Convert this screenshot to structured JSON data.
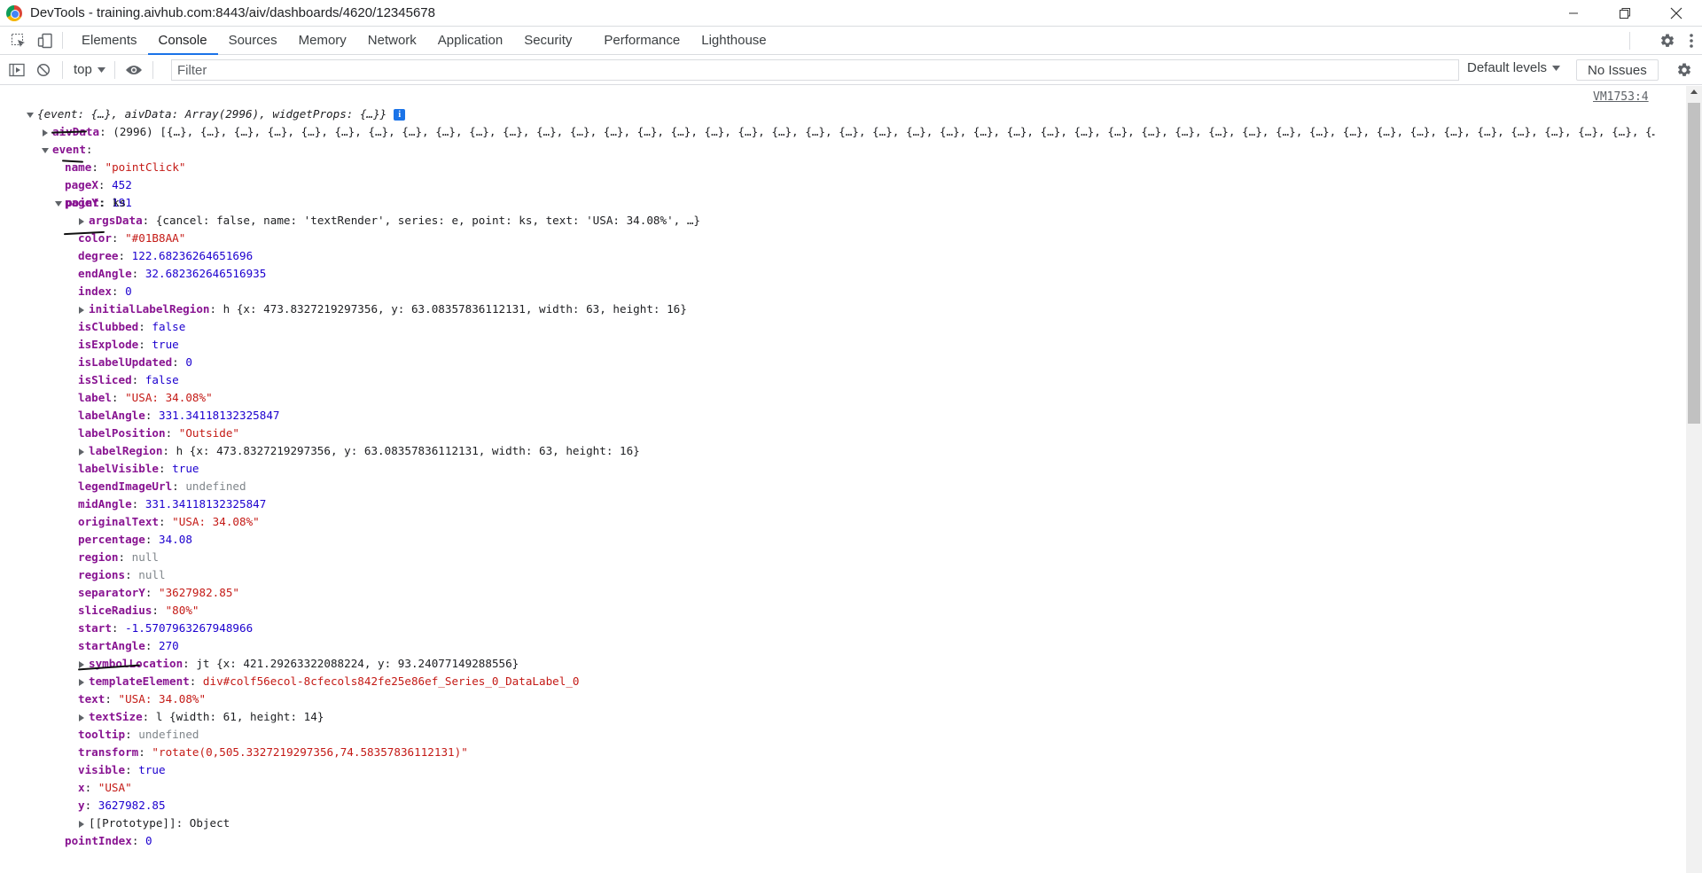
{
  "window": {
    "title": "DevTools - training.aivhub.com:8443/aiv/dashboards/4620/12345678",
    "controls": [
      "minimize",
      "restore",
      "close"
    ]
  },
  "tabs": [
    {
      "label": "Elements",
      "active": false
    },
    {
      "label": "Console",
      "active": true
    },
    {
      "label": "Sources",
      "active": false
    },
    {
      "label": "Memory",
      "active": false
    },
    {
      "label": "Network",
      "active": false
    },
    {
      "label": "Application",
      "active": false
    },
    {
      "label": "Security",
      "active": false
    },
    {
      "label": "Performance",
      "active": false
    },
    {
      "label": "Lighthouse",
      "active": false
    }
  ],
  "toolbar": {
    "context": "top",
    "filter_placeholder": "Filter",
    "levels": "Default levels",
    "issues": "No Issues"
  },
  "console": {
    "source_link": "VM1753:4",
    "summary": {
      "text": "{event: {…}, aivData: Array(2996), widgetProps: {…}}"
    },
    "aivData": {
      "key": "aivData",
      "count": "(2996)",
      "preview": "[{…}, {…}, {…}, {…}, {…}, {…}, {…}, {…}, {…}, {…}, {…}, {…}, {…}, {…}, {…}, {…}, {…}, {…}, {…}, {…}, {…}, {…}, {…}, {…}, {…}, {…}, {…}, {…}, {…}, {…}, {…}, {…}, {…}, {…}, {…}, {…}, {…}, {…}, {…}, {…}, {…}, {…}, {…}, {…}, {…}, {…}, {…}, {…}, {…}, {…}, {…}, {…}, {…}, {…}, {…}, {…}, {…}, {…}, {…}, {…}, {…}, {…}, {…}, {…}, {…}, {…}, {…}, {…}, {…}, {…}, {…}, {…}, {…}, {…}, {…}, {…}, {…}, {…}, {…}, {…}, {…}, {…}, {…}, {…}, {…}, {…}, {…}, {…}, {…}, {…}, {…}, {…}, {…}, {…}, {…}, {…}, {…}, {…}, {…}, {…}, …]"
    },
    "event_key": "event",
    "event_props": [
      {
        "key": "name",
        "value": "\"pointClick\"",
        "type": "string"
      },
      {
        "key": "pageX",
        "value": "452",
        "type": "number"
      },
      {
        "key": "pageY",
        "value": "191",
        "type": "number"
      }
    ],
    "point": {
      "key": "point",
      "value": "ks"
    },
    "point_props": [
      {
        "key": "argsData",
        "expandable": true,
        "value": "{cancel: false, name: 'textRender', series: e, point: ks, text: 'USA: 34.08%', …}",
        "type": "object"
      },
      {
        "key": "color",
        "value": "\"#01B8AA\"",
        "type": "string"
      },
      {
        "key": "degree",
        "value": "122.68236264651696",
        "type": "number"
      },
      {
        "key": "endAngle",
        "value": "32.682362646516935",
        "type": "number"
      },
      {
        "key": "index",
        "value": "0",
        "type": "number"
      },
      {
        "key": "initialLabelRegion",
        "expandable": true,
        "value": "h {x: 473.8327219297356, y: 63.08357836112131, width: 63, height: 16}",
        "type": "object"
      },
      {
        "key": "isClubbed",
        "value": "false",
        "type": "number"
      },
      {
        "key": "isExplode",
        "value": "true",
        "type": "number"
      },
      {
        "key": "isLabelUpdated",
        "value": "0",
        "type": "number"
      },
      {
        "key": "isSliced",
        "value": "false",
        "type": "number"
      },
      {
        "key": "label",
        "value": "\"USA: 34.08%\"",
        "type": "string"
      },
      {
        "key": "labelAngle",
        "value": "331.34118132325847",
        "type": "number"
      },
      {
        "key": "labelPosition",
        "value": "\"Outside\"",
        "type": "string"
      },
      {
        "key": "labelRegion",
        "expandable": true,
        "value": "h {x: 473.8327219297356, y: 63.08357836112131, width: 63, height: 16}",
        "type": "object"
      },
      {
        "key": "labelVisible",
        "value": "true",
        "type": "number"
      },
      {
        "key": "legendImageUrl",
        "value": "undefined",
        "type": "null"
      },
      {
        "key": "midAngle",
        "value": "331.34118132325847",
        "type": "number"
      },
      {
        "key": "originalText",
        "value": "\"USA: 34.08%\"",
        "type": "string"
      },
      {
        "key": "percentage",
        "value": "34.08",
        "type": "number"
      },
      {
        "key": "region",
        "value": "null",
        "type": "null"
      },
      {
        "key": "regions",
        "value": "null",
        "type": "null"
      },
      {
        "key": "separatorY",
        "value": "\"3627982.85\"",
        "type": "string"
      },
      {
        "key": "sliceRadius",
        "value": "\"80%\"",
        "type": "string"
      },
      {
        "key": "start",
        "value": "-1.5707963267948966",
        "type": "number"
      },
      {
        "key": "startAngle",
        "value": "270",
        "type": "number"
      },
      {
        "key": "symbolLocation",
        "expandable": true,
        "value": "jt {x: 421.29263322088224, y: 93.24077149288556}",
        "type": "object"
      },
      {
        "key": "templateElement",
        "expandable": true,
        "value": "div#colf56ecol-8cfecols842fe25e86ef_Series_0_DataLabel_0",
        "type": "string"
      },
      {
        "key": "text",
        "value": "\"USA: 34.08%\"",
        "type": "string"
      },
      {
        "key": "textSize",
        "expandable": true,
        "value": "l {width: 61, height: 14}",
        "type": "object"
      },
      {
        "key": "tooltip",
        "value": "undefined",
        "type": "null"
      },
      {
        "key": "transform",
        "value": "\"rotate(0,505.3327219297356,74.58357836112131)\"",
        "type": "string"
      },
      {
        "key": "visible",
        "value": "true",
        "type": "number"
      },
      {
        "key": "x",
        "value": "\"USA\"",
        "type": "string"
      },
      {
        "key": "y",
        "value": "3627982.85",
        "type": "number"
      },
      {
        "key": "[[Prototype]]",
        "expandable": true,
        "value": "Object",
        "type": "plain",
        "plainkey": true
      }
    ],
    "after_point": [
      {
        "key": "pointIndex",
        "value": "0",
        "type": "number"
      }
    ]
  }
}
